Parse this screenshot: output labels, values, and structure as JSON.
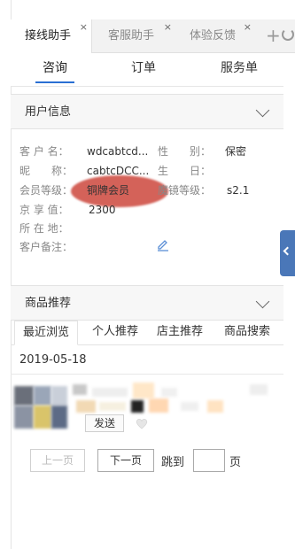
{
  "top_tabs": [
    {
      "label": "接线助手",
      "close": "×"
    },
    {
      "label": "客服助手",
      "close": "×"
    },
    {
      "label": "体验反馈",
      "close": "×"
    }
  ],
  "sub_tabs": [
    "咨询",
    "订单",
    "服务单"
  ],
  "user_section": {
    "title": "用户信息",
    "rows": [
      {
        "label": "客 户 名：",
        "value": "wdcabtcd...",
        "label2": "性　　别：",
        "value2": "保密"
      },
      {
        "label": "昵　　称：",
        "value": "cabtcDCC...",
        "label2": "生　　日：",
        "value2": ""
      },
      {
        "label": "会员等级：",
        "value": "铜牌会员",
        "label2": "魔镜等级：",
        "value2": "s2.1"
      },
      {
        "label": "京 享 值：",
        "value": "2300"
      },
      {
        "label": "所 在 地：",
        "value": ""
      },
      {
        "label": "客户备注：",
        "value": ""
      }
    ]
  },
  "product_section": {
    "title": "商品推荐",
    "tabs": [
      "最近浏览",
      "个人推荐",
      "店主推荐",
      "商品搜索"
    ],
    "date": "2019-05-18",
    "send_label": "发送"
  },
  "pagination": {
    "prev": "上一页",
    "next": "下一页",
    "jump": "跳到",
    "page_unit": "页"
  },
  "colors": {
    "accent": "#2a6fd3",
    "handle": "#4a77b8",
    "stamp": "#cd463c"
  }
}
